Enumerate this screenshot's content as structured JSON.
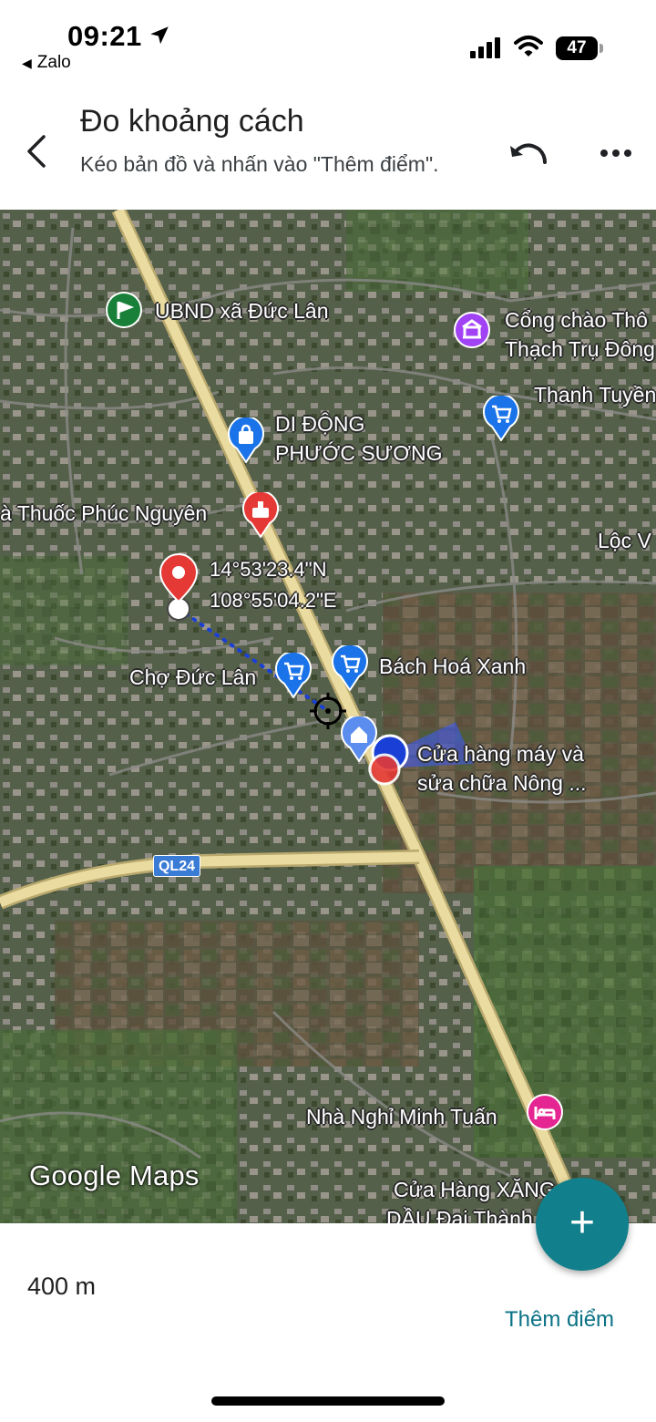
{
  "status_bar": {
    "time": "09:21",
    "back_app": "Zalo",
    "battery": "47",
    "icons": [
      "location-arrow-icon",
      "signal-icon",
      "wifi-icon",
      "battery-icon"
    ]
  },
  "header": {
    "title": "Đo khoảng cách",
    "subtitle": "Kéo bản đồ và nhấn vào \"Thêm điểm\".",
    "icons": [
      "back-arrow-icon",
      "undo-icon",
      "more-horiz-icon"
    ]
  },
  "map": {
    "places": {
      "ubnd": "UBND xã Đức Lân",
      "cong_chao_1": "Cổng chào Thô",
      "cong_chao_2": "Thạch Trụ Đông",
      "di_dong_1": "DI ĐỘNG",
      "di_dong_2": "PHƯỚC SƯƠNG",
      "thanh_tuyen": "Thanh Tuyền",
      "thuoc": "à Thuốc Phúc Nguyên",
      "loc_v": "Lộc V",
      "cho_duc_lan": "Chợ Đức Lân",
      "bach_hoa_xanh": "Bách Hoá Xanh",
      "cua_hang_1": "Cửa hàng máy và",
      "cua_hang_2": "sửa chữa Nông ...",
      "nha_nghi": "Nhà Nghỉ Minh Tuấn",
      "xang_1": "Cửa Hàng XĂNG",
      "xang_2": "DẦU Đại Thành"
    },
    "coordinates": {
      "lat": "14°53'23.4\"N",
      "lng": "108°55'04.2\"E"
    },
    "road_shield": "QL24",
    "logo": "Google Maps",
    "colors": {
      "road": "#e8d9a0",
      "measure_line": "#1a3fd6",
      "pin_red": "#e53935",
      "pin_blue": "#1a73e8",
      "pin_purple": "#a142f4",
      "pin_pink": "#e52592",
      "pin_green": "#188038"
    }
  },
  "bottom": {
    "distance": "400 m",
    "add_point": "Thêm điểm",
    "fab_symbol": "+"
  }
}
